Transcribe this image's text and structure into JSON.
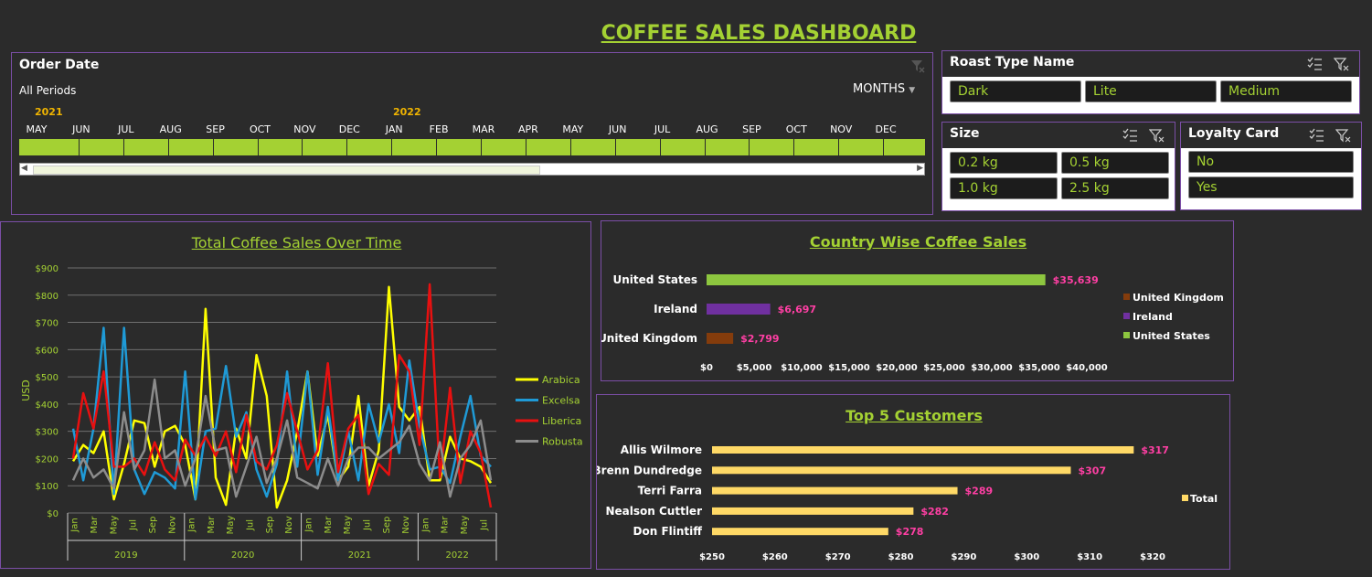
{
  "dashboard_title": "COFFEE SALES DASHBOARD",
  "timeline": {
    "header": "Order Date",
    "periods_label": "All Periods",
    "level_label": "MONTHS",
    "years": [
      {
        "label": "2021"
      },
      {
        "label": "2022"
      }
    ],
    "months": [
      "MAY",
      "JUN",
      "JUL",
      "AUG",
      "SEP",
      "OCT",
      "NOV",
      "DEC",
      "JAN",
      "FEB",
      "MAR",
      "APR",
      "MAY",
      "JUN",
      "JUL",
      "AUG",
      "SEP",
      "OCT",
      "NOV",
      "DEC"
    ]
  },
  "slicers": {
    "roast": {
      "header": "Roast Type Name",
      "items": [
        "Dark",
        "Lite",
        "Medium"
      ]
    },
    "size": {
      "header": "Size",
      "items": [
        "0.2 kg",
        "0.5 kg",
        "1.0 kg",
        "2.5 kg"
      ]
    },
    "loyalty": {
      "header": "Loyalty Card",
      "items": [
        "No",
        "Yes"
      ]
    }
  },
  "colors": {
    "accent": "#a4d133",
    "arabica": "#ffff00",
    "excelsa": "#1f9ad6",
    "liberica": "#e81010",
    "robusta": "#8c8c8c",
    "us": "#8dc63f",
    "ireland": "#7030a0",
    "uk": "#843c0c",
    "customers": "#ffd966",
    "data_label": "#ff3fa4"
  },
  "chart_data": [
    {
      "type": "line",
      "title": "Total Coffee Sales Over Time",
      "ylabel": "USD",
      "ylim": [
        0,
        900
      ],
      "yticks": [
        "$0",
        "$100",
        "$200",
        "$300",
        "$400",
        "$500",
        "$600",
        "$700",
        "$800",
        "$900"
      ],
      "x_month_labels": [
        "Jan",
        "Mar",
        "May",
        "Jul",
        "Sep",
        "Nov",
        "Jan",
        "Mar",
        "May",
        "Jul",
        "Sep",
        "Nov",
        "Jan",
        "Mar",
        "May",
        "Jul",
        "Sep",
        "Nov",
        "Jan",
        "Mar",
        "May",
        "Jul"
      ],
      "x_years": [
        "2019",
        "2020",
        "2021",
        "2022"
      ],
      "grid": true,
      "legend_position": "right",
      "series": [
        {
          "name": "Arabica",
          "values": [
            190,
            250,
            220,
            300,
            50,
            180,
            340,
            330,
            170,
            300,
            320,
            250,
            50,
            750,
            130,
            30,
            310,
            200,
            580,
            430,
            20,
            120,
            300,
            520,
            210,
            360,
            120,
            170,
            430,
            100,
            230,
            830,
            390,
            340,
            390,
            120,
            120,
            280,
            200,
            190,
            170,
            110
          ]
        },
        {
          "name": "Excelsa",
          "values": [
            310,
            120,
            310,
            680,
            70,
            680,
            160,
            70,
            150,
            130,
            90,
            520,
            50,
            300,
            310,
            540,
            280,
            370,
            160,
            60,
            180,
            520,
            170,
            520,
            140,
            390,
            120,
            300,
            120,
            400,
            260,
            400,
            220,
            560,
            320,
            160,
            170,
            110,
            280,
            430,
            210,
            170
          ]
        },
        {
          "name": "Liberica",
          "values": [
            200,
            440,
            310,
            520,
            170,
            170,
            200,
            140,
            260,
            160,
            120,
            270,
            210,
            280,
            210,
            300,
            150,
            360,
            190,
            160,
            250,
            440,
            300,
            160,
            230,
            550,
            150,
            310,
            360,
            70,
            180,
            140,
            580,
            520,
            250,
            840,
            130,
            460,
            110,
            300,
            220,
            20
          ]
        },
        {
          "name": "Robusta",
          "values": [
            120,
            200,
            130,
            160,
            90,
            370,
            160,
            230,
            490,
            200,
            230,
            100,
            200,
            430,
            230,
            240,
            60,
            170,
            280,
            110,
            200,
            340,
            130,
            110,
            90,
            200,
            100,
            200,
            240,
            240,
            200,
            230,
            260,
            320,
            180,
            120,
            260,
            60,
            200,
            250,
            340,
            120
          ]
        }
      ]
    },
    {
      "type": "bar",
      "title": "Country Wise Coffee Sales",
      "orientation": "horizontal",
      "categories": [
        "United States",
        "Ireland",
        "United Kingdom"
      ],
      "values": [
        35639,
        6697,
        2799
      ],
      "value_labels": [
        "$35,639",
        "$6,697",
        "$2,799"
      ],
      "xlim": [
        0,
        40000
      ],
      "xticks": [
        "$0",
        "$5,000",
        "$10,000",
        "$15,000",
        "$20,000",
        "$25,000",
        "$30,000",
        "$35,000",
        "$40,000"
      ],
      "legend": [
        "United Kingdom",
        "Ireland",
        "United States"
      ],
      "legend_position": "right"
    },
    {
      "type": "bar",
      "title": "Top 5 Customers",
      "orientation": "horizontal",
      "categories": [
        "Allis Wilmore",
        "Brenn Dundredge",
        "Terri Farra",
        "Nealson Cuttler",
        "Don Flintiff"
      ],
      "values": [
        317,
        307,
        289,
        282,
        278
      ],
      "value_labels": [
        "$317",
        "$307",
        "$289",
        "$282",
        "$278"
      ],
      "xlim": [
        250,
        320
      ],
      "xticks": [
        "$250",
        "$260",
        "$270",
        "$280",
        "$290",
        "$300",
        "$310",
        "$320"
      ],
      "legend": [
        "Total"
      ],
      "legend_position": "right"
    }
  ]
}
